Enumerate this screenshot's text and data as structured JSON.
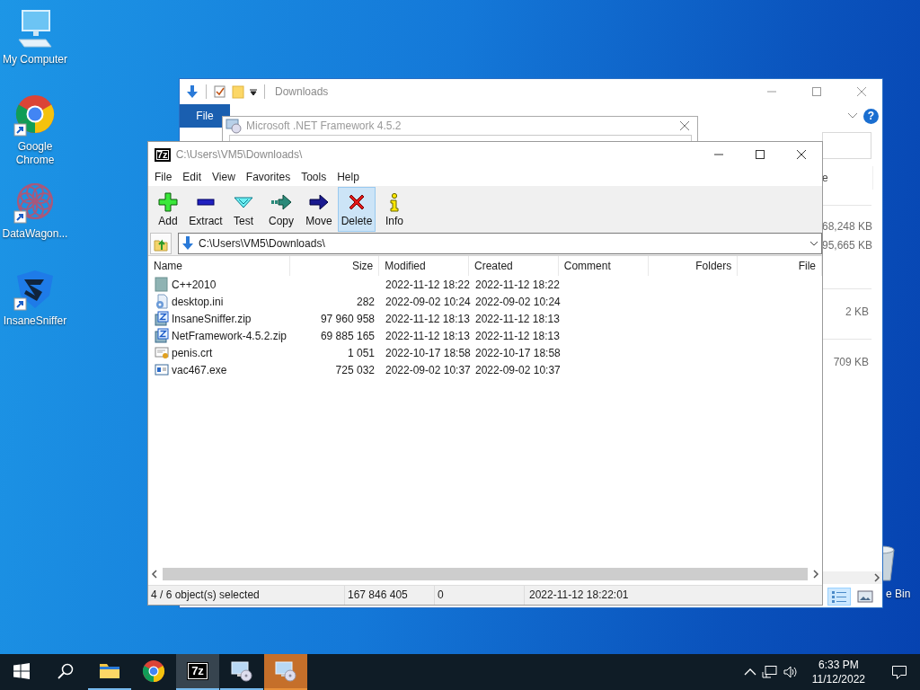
{
  "desktop_icons": [
    {
      "label": "My Computer",
      "kind": "computer",
      "shortcut": false
    },
    {
      "label": "Google Chrome",
      "kind": "browser",
      "shortcut": true
    },
    {
      "label": "DataWagon...",
      "kind": "mandala",
      "shortcut": true
    },
    {
      "label": "InsaneSniffer",
      "kind": "shield",
      "shortcut": true
    }
  ],
  "recycle_bin": {
    "label": "e Bin"
  },
  "explorer_window": {
    "title": "Downloads",
    "ribbon_tabs": [
      {
        "label": "File",
        "selected": true
      }
    ],
    "help_glyph": "?",
    "column_fragment": "e",
    "sizes": [
      "68,248 KB",
      "95,665 KB",
      "2 KB",
      "709 KB"
    ]
  },
  "dotnet_dialog": {
    "title": "Microsoft .NET Framework 4.5.2"
  },
  "sevenzip_window": {
    "logo": "7z",
    "title": "C:\\Users\\VM5\\Downloads\\",
    "menu": [
      "File",
      "Edit",
      "View",
      "Favorites",
      "Tools",
      "Help"
    ],
    "toolbar": [
      {
        "label": "Add",
        "kind": "add",
        "hovered": false
      },
      {
        "label": "Extract",
        "kind": "extract",
        "hovered": false
      },
      {
        "label": "Test",
        "kind": "test",
        "hovered": false
      },
      {
        "label": "Copy",
        "kind": "copy",
        "hovered": false
      },
      {
        "label": "Move",
        "kind": "move",
        "hovered": false
      },
      {
        "label": "Delete",
        "kind": "delete",
        "hovered": true
      },
      {
        "label": "Info",
        "kind": "info",
        "hovered": false
      }
    ],
    "address": "C:\\Users\\VM5\\Downloads\\",
    "columns": [
      "Name",
      "Size",
      "Modified",
      "Created",
      "Comment",
      "Folders",
      "File"
    ],
    "rows": [
      {
        "name": "C++2010",
        "kind": "folder",
        "size": "",
        "modified": "2022-11-12 18:22",
        "created": "2022-11-12 18:22"
      },
      {
        "name": "desktop.ini",
        "kind": "settings",
        "size": "282",
        "modified": "2022-09-02 10:24",
        "created": "2022-09-02 10:24"
      },
      {
        "name": "InsaneSniffer.zip",
        "kind": "archive",
        "size": "97 960 958",
        "modified": "2022-11-12 18:13",
        "created": "2022-11-12 18:13"
      },
      {
        "name": "NetFramework-4.5.2.zip",
        "kind": "archive",
        "size": "69 885 165",
        "modified": "2022-11-12 18:13",
        "created": "2022-11-12 18:13"
      },
      {
        "name": "penis.crt",
        "kind": "certificate",
        "size": "1 051",
        "modified": "2022-10-17 18:58",
        "created": "2022-10-17 18:58"
      },
      {
        "name": "vac467.exe",
        "kind": "program",
        "size": "725 032",
        "modified": "2022-09-02 10:37",
        "created": "2022-09-02 10:37"
      }
    ],
    "status": [
      "4 / 6 object(s) selected",
      "167 846 405",
      "0",
      "2022-11-12 18:22:01"
    ]
  },
  "taskbar": {
    "apps": [
      {
        "kind": "explorer",
        "running": true,
        "active": false,
        "flashing": false
      },
      {
        "kind": "browser",
        "running": false,
        "active": false,
        "flashing": false
      },
      {
        "kind": "archiver",
        "running": true,
        "active": true,
        "flashing": false,
        "logo": "7z"
      },
      {
        "kind": "setup",
        "running": true,
        "active": false,
        "flashing": false
      },
      {
        "kind": "setup",
        "running": true,
        "active": false,
        "flashing": true
      }
    ],
    "clock": {
      "time": "6:33 PM",
      "date": "11/12/2022"
    }
  }
}
